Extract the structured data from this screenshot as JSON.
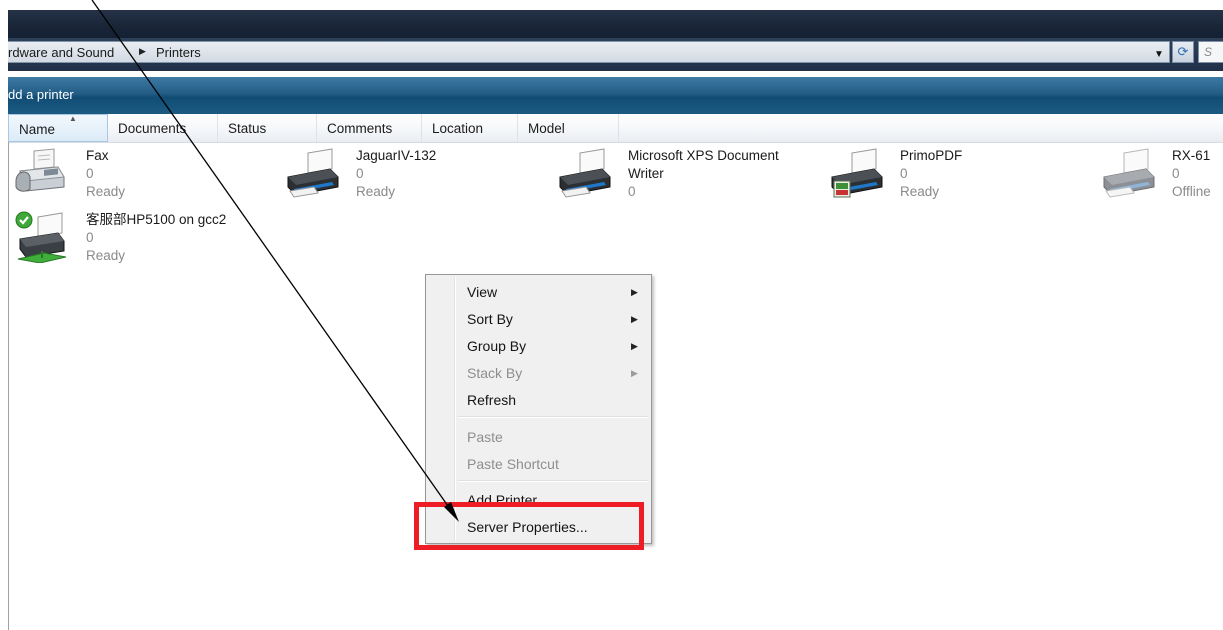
{
  "address_bar": {
    "crumbs": [
      "rdware and Sound",
      "Printers"
    ],
    "search_placeholder": "S"
  },
  "command_bar": {
    "add_printer": "dd a printer"
  },
  "columns": [
    {
      "label": "Name"
    },
    {
      "label": "Documents"
    },
    {
      "label": "Status"
    },
    {
      "label": "Comments"
    },
    {
      "label": "Location"
    },
    {
      "label": "Model"
    }
  ],
  "printers": [
    {
      "name": "Fax",
      "docs": "0",
      "status": "Ready"
    },
    {
      "name": "JaguarIV-132",
      "docs": "0",
      "status": "Ready"
    },
    {
      "name_line1": "Microsoft XPS Document",
      "name_line2": "Writer",
      "docs": "0"
    },
    {
      "name": "PrimoPDF",
      "docs": "0",
      "status": "Ready"
    },
    {
      "name": "RX-61",
      "docs": "0",
      "status": "Offline"
    },
    {
      "name": "客服部HP5100 on gcc2",
      "docs": "0",
      "status": "Ready"
    }
  ],
  "context_menu": {
    "items": [
      {
        "label": "View",
        "submenu": true,
        "disabled": false
      },
      {
        "label": "Sort By",
        "submenu": true,
        "disabled": false
      },
      {
        "label": "Group By",
        "submenu": true,
        "disabled": false
      },
      {
        "label": "Stack By",
        "submenu": true,
        "disabled": true
      },
      {
        "label": "Refresh",
        "submenu": false,
        "disabled": false
      },
      {
        "label": "Paste",
        "submenu": false,
        "disabled": true
      },
      {
        "label": "Paste Shortcut",
        "submenu": false,
        "disabled": true
      },
      {
        "label": "Add Printer",
        "submenu": false,
        "disabled": false
      },
      {
        "label": "Server Properties...",
        "submenu": false,
        "disabled": false
      }
    ]
  },
  "colors": {
    "highlight": "#ee1c24",
    "command_bar": "#235d86",
    "menu_background": "#f0f0f0",
    "disabled_text": "#8e8e8e"
  },
  "icons": [
    "printer-icon",
    "fax-icon",
    "default-check-icon",
    "pdf-badge-icon",
    "network-icon",
    "chevron-right-icon",
    "chevron-down-icon",
    "refresh-icon",
    "sort-up-icon"
  ]
}
